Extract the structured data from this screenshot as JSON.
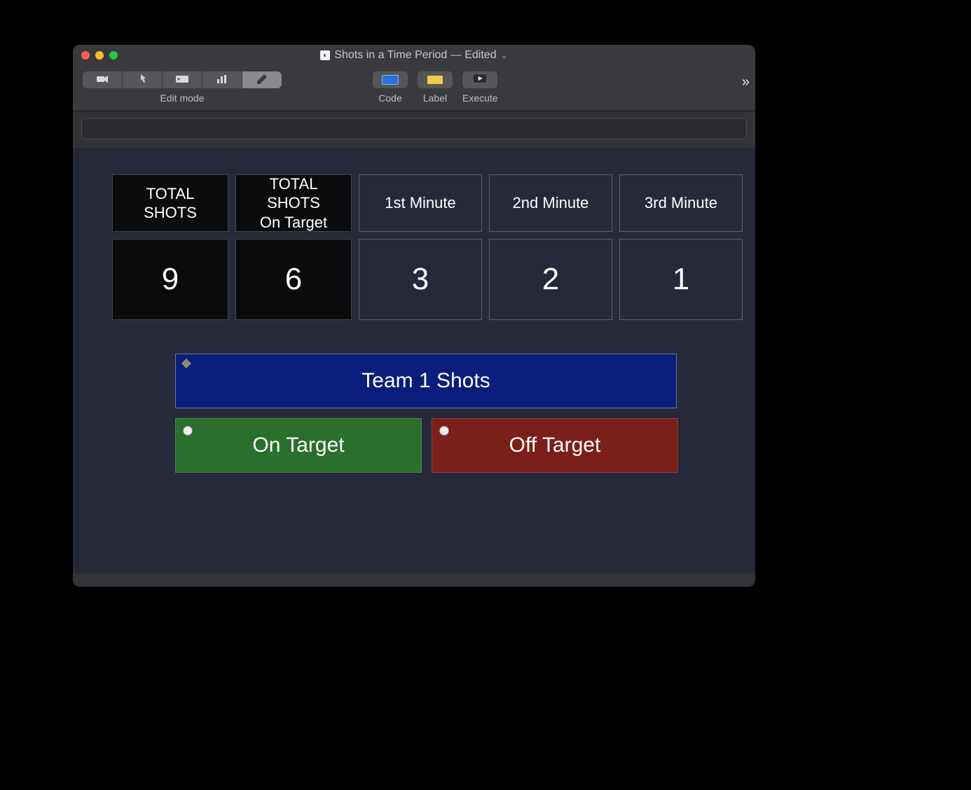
{
  "window": {
    "title": "Shots in a Time Period — Edited"
  },
  "toolbar": {
    "edit_mode_label": "Edit mode",
    "code_label": "Code",
    "label_label": "Label",
    "execute_label": "Execute"
  },
  "stats": {
    "headers": {
      "total_shots": "TOTAL SHOTS",
      "total_on_target_line1": "TOTAL SHOTS",
      "total_on_target_line2": "On Target",
      "min1": "1st Minute",
      "min2": "2nd Minute",
      "min3": "3rd Minute"
    },
    "values": {
      "total_shots": "9",
      "total_on_target": "6",
      "min1": "3",
      "min2": "2",
      "min3": "1"
    }
  },
  "buttons": {
    "team1": "Team 1 Shots",
    "on_target": "On Target",
    "off_target": "Off Target"
  }
}
